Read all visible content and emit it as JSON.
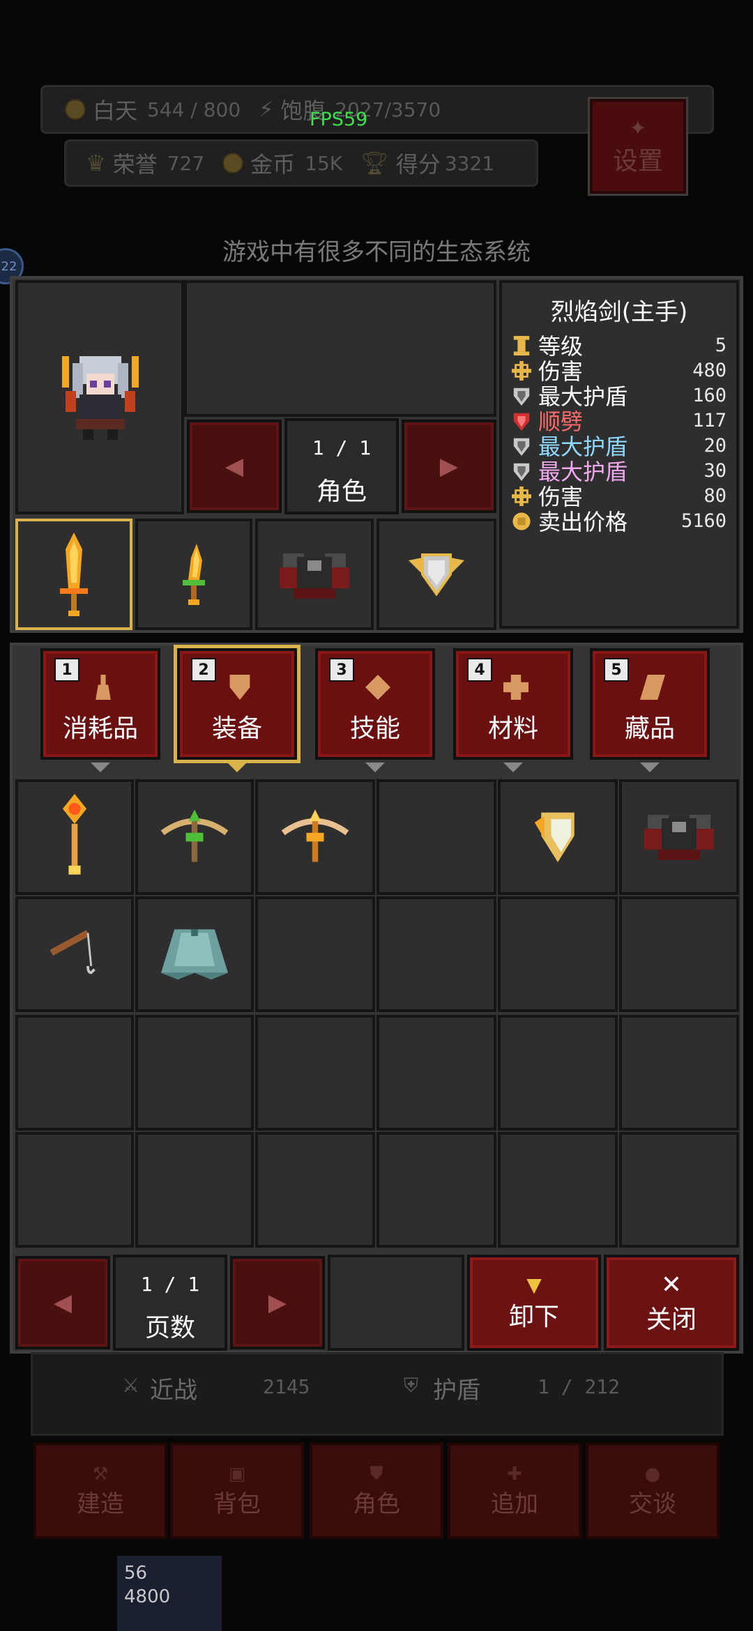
{
  "hud": {
    "daytime_label": "白天",
    "daytime_value": "544 / 800",
    "food_label": "饱腹",
    "food_value": "2027/3570",
    "fps": "FPS59",
    "honor_label": "荣誉",
    "honor_value": "727",
    "gold_label": "金币",
    "gold_value": "15K",
    "score_label": "得分",
    "score_value": "3321",
    "settings_label": "设置"
  },
  "tip": "游戏中有很多不同的生态系统",
  "side_badge": "22",
  "character_pager": {
    "page": "1 / 1",
    "label": "角色"
  },
  "item_stats": {
    "title": "烈焰剑(主手)",
    "rows": [
      {
        "icon": "level-icon",
        "label": "等级",
        "value": "5",
        "color": "#ffffff"
      },
      {
        "icon": "damage-icon",
        "label": "伤害",
        "value": "480",
        "color": "#ffffff"
      },
      {
        "icon": "shield-icon",
        "label": "最大护盾",
        "value": "160",
        "color": "#ffffff"
      },
      {
        "icon": "cleave-icon",
        "label": "顺劈",
        "value": "117",
        "color": "#ff6a6a"
      },
      {
        "icon": "shield-icon",
        "label": "最大护盾",
        "value": "20",
        "color": "#8fd8ff"
      },
      {
        "icon": "shield-icon",
        "label": "最大护盾",
        "value": "30",
        "color": "#f0a8f0"
      },
      {
        "icon": "damage-icon",
        "label": "伤害",
        "value": "80",
        "color": "#ffffff"
      },
      {
        "icon": "coin-icon",
        "label": "卖出价格",
        "value": "5160",
        "color": "#ffffff"
      }
    ]
  },
  "tabs": [
    {
      "num": "1",
      "label": "消耗品",
      "icon": "potion-icon",
      "active": false
    },
    {
      "num": "2",
      "label": "装备",
      "icon": "armor-icon",
      "active": true
    },
    {
      "num": "3",
      "label": "技能",
      "icon": "diamond-icon",
      "active": false
    },
    {
      "num": "4",
      "label": "材料",
      "icon": "material-icon",
      "active": false
    },
    {
      "num": "5",
      "label": "藏品",
      "icon": "scroll-icon",
      "active": false
    }
  ],
  "inventory_pager": {
    "page": "1 / 1",
    "label": "页数"
  },
  "actions": {
    "unequip": "卸下",
    "close": "关闭"
  },
  "under": {
    "melee_label": "近战",
    "melee_value": "2145",
    "shield_label": "护盾",
    "shield_value": "1 / 212",
    "menu": [
      "建造",
      "背包",
      "角色",
      "追加",
      "交谈"
    ],
    "unit_top": "56",
    "unit_bottom": "4800"
  },
  "colors": {
    "accent_gold": "#d8b44a",
    "button_red": "#6b1212",
    "fps_green": "#3ee04a"
  }
}
